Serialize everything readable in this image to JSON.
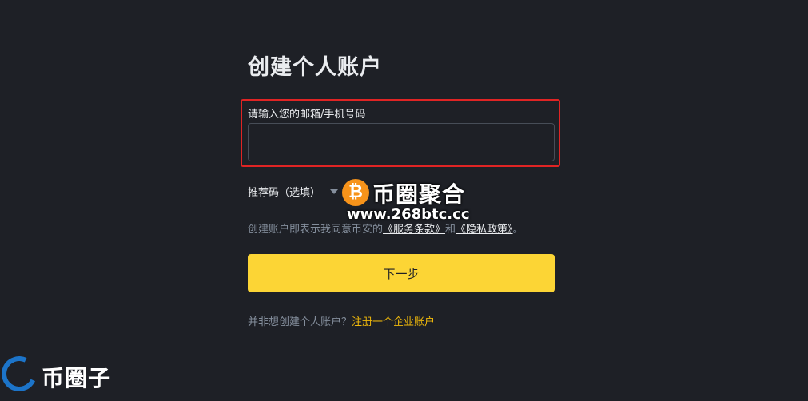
{
  "form": {
    "title": "创建个人账户",
    "email_label": "请输入您的邮箱/手机号码",
    "email_value": "",
    "referral_label": "推荐码（选填）",
    "terms_prefix": "创建账户即表示我同意币安的",
    "terms_link": "《服务条款》",
    "terms_and": "和",
    "privacy_link": "《隐私政策》",
    "terms_suffix": "。",
    "next_button": "下一步",
    "business_prompt": "并非想创建个人账户？",
    "business_link": "注册一个企业账户"
  },
  "watermark": {
    "coin_symbol": "₿",
    "name": "币圈聚合",
    "url": "www.268btc.cc"
  },
  "corner_logo": {
    "text": "币圈子"
  },
  "colors": {
    "background": "#1e2026",
    "accent_yellow": "#fcd535",
    "link_yellow": "#f0b90b",
    "highlight_red": "#e02424"
  }
}
